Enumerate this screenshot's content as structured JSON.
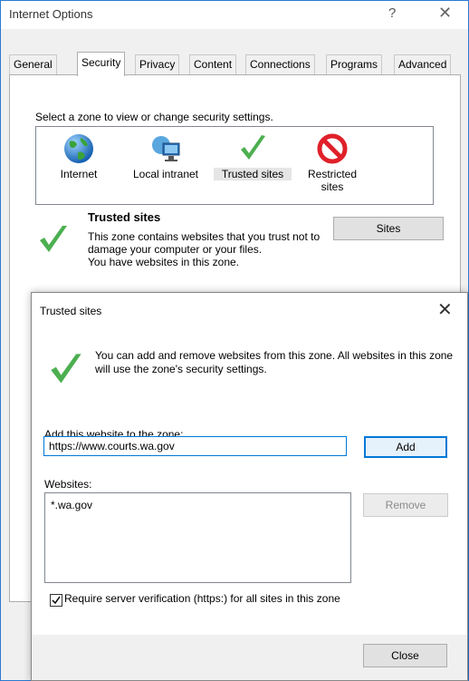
{
  "window": {
    "title": "Internet Options",
    "help_glyph": "?",
    "close_glyph": "✕"
  },
  "tabs": [
    {
      "label": "General"
    },
    {
      "label": "Security",
      "active": true
    },
    {
      "label": "Privacy"
    },
    {
      "label": "Content"
    },
    {
      "label": "Connections"
    },
    {
      "label": "Programs"
    },
    {
      "label": "Advanced"
    }
  ],
  "security": {
    "zone_prompt": "Select a zone to view or change security settings.",
    "zones": [
      {
        "label": "Internet",
        "icon": "globe-icon"
      },
      {
        "label": "Local intranet",
        "icon": "intranet-icon"
      },
      {
        "label": "Trusted sites",
        "icon": "checkmark-icon",
        "selected": true
      },
      {
        "label": "Restricted sites",
        "icon": "restricted-icon"
      }
    ],
    "zone_title": "Trusted sites",
    "zone_description": "This zone contains websites that you trust not to damage your computer or your files.\nYou have websites in this zone.",
    "sites_button": "Sites"
  },
  "dialog": {
    "title": "Trusted sites",
    "close_glyph": "✕",
    "description": "You can add and remove websites from this zone. All websites in this zone will use the zone's security settings.",
    "add_label": "Add this website to the zone:",
    "url_value": "https://www.courts.wa.gov",
    "add_button": "Add",
    "websites_label": "Websites:",
    "websites": [
      "*.wa.gov"
    ],
    "remove_button": "Remove",
    "require_verification_label": "Require server verification (https:) for all sites in this zone",
    "require_verification_checked": true,
    "close_button": "Close"
  },
  "colors": {
    "accent": "#0078d7",
    "check_green": "#4caf50",
    "restricted_red": "#e0202a"
  }
}
